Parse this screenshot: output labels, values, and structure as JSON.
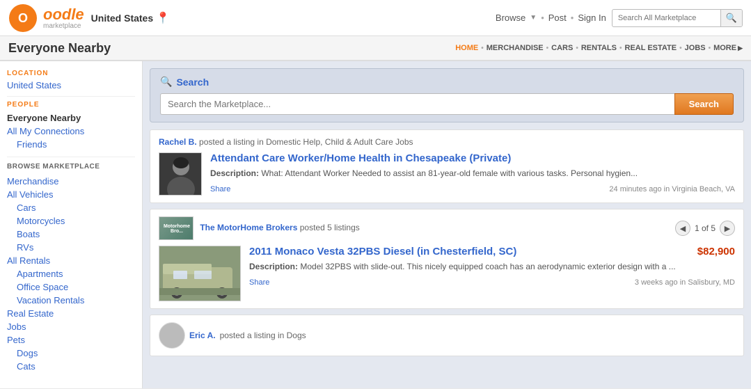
{
  "header": {
    "logo_text": "oodle",
    "logo_sub": "marketplace",
    "location": "United States",
    "nav": {
      "browse": "Browse",
      "post": "Post",
      "sign_in": "Sign In"
    },
    "search_placeholder": "Search All Marketplace"
  },
  "nav_bar": {
    "page_title": "Everyone Nearby",
    "categories": [
      {
        "label": "HOME",
        "active": true
      },
      {
        "label": "MERCHANDISE",
        "active": false
      },
      {
        "label": "CARS",
        "active": false
      },
      {
        "label": "RENTALS",
        "active": false
      },
      {
        "label": "REAL ESTATE",
        "active": false
      },
      {
        "label": "JOBS",
        "active": false
      },
      {
        "label": "MORE",
        "active": false
      }
    ]
  },
  "sidebar": {
    "location_title": "LOCATION",
    "location_value": "United States",
    "people_title": "PEOPLE",
    "people_items": [
      {
        "label": "Everyone Nearby",
        "active": true
      },
      {
        "label": "All My Connections",
        "active": false
      },
      {
        "label": "Friends",
        "active": false
      }
    ],
    "browse_title": "BROWSE MARKETPLACE",
    "browse_items": [
      {
        "label": "Merchandise",
        "indent": 0
      },
      {
        "label": "All Vehicles",
        "indent": 0
      },
      {
        "label": "Cars",
        "indent": 1
      },
      {
        "label": "Motorcycles",
        "indent": 1
      },
      {
        "label": "Boats",
        "indent": 1
      },
      {
        "label": "RVs",
        "indent": 1
      },
      {
        "label": "All Rentals",
        "indent": 0
      },
      {
        "label": "Apartments",
        "indent": 1
      },
      {
        "label": "Office Space",
        "indent": 1
      },
      {
        "label": "Vacation Rentals",
        "indent": 1
      },
      {
        "label": "Real Estate",
        "indent": 0
      },
      {
        "label": "Jobs",
        "indent": 0
      },
      {
        "label": "Pets",
        "indent": 0
      },
      {
        "label": "Dogs",
        "indent": 1
      },
      {
        "label": "Cats",
        "indent": 1
      }
    ]
  },
  "search_section": {
    "title": "Search",
    "placeholder": "Search the Marketplace...",
    "button_label": "Search"
  },
  "listings": [
    {
      "id": 1,
      "user": "Rachel B.",
      "action": "posted a listing in Domestic Help, Child & Adult Care Jobs",
      "title": "Attendant Care Worker/Home Health in Chesapeake (Private)",
      "description": "What: Attendant Worker Needed to assist an 81-year-old female with various tasks. Personal hygien...",
      "share_label": "Share",
      "time": "24 minutes ago in Virginia Beach, VA",
      "has_pagination": false,
      "has_price": false,
      "has_inner_image": false
    },
    {
      "id": 2,
      "user": "The MotorHome Brokers",
      "action": "posted 5 listings",
      "pagination": "1 of 5",
      "page_current": 1,
      "page_total": 5,
      "title": "2011 Monaco Vesta 32PBS Diesel (in Chesterfield, SC)",
      "description": "Model 32PBS with slide-out. This nicely equipped coach has an aerodynamic exterior design with a ...",
      "price": "$82,900",
      "share_label": "Share",
      "time": "3 weeks ago in Salisbury, MD",
      "has_pagination": true,
      "has_price": true,
      "has_inner_image": true
    },
    {
      "id": 3,
      "user": "Eric A.",
      "action": "posted a listing in Dogs",
      "title": "",
      "description": "",
      "share_label": "",
      "time": "",
      "has_pagination": false,
      "has_price": false,
      "has_inner_image": false,
      "partial": true
    }
  ]
}
